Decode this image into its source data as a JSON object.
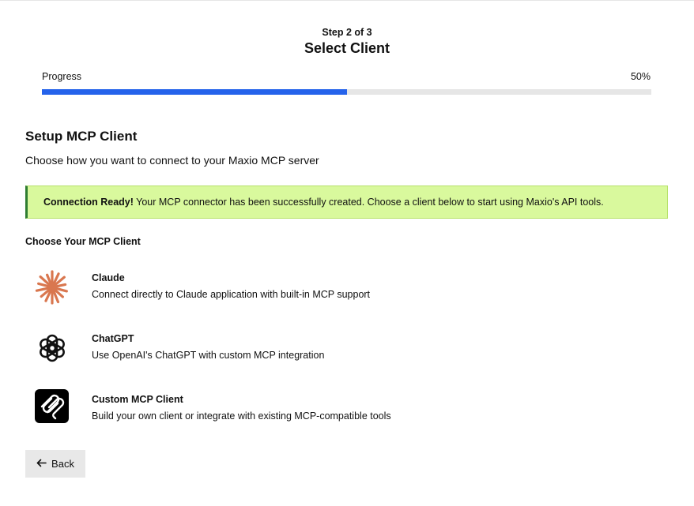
{
  "wizard": {
    "step_label": "Step 2 of 3",
    "title": "Select Client",
    "progress_label": "Progress",
    "progress_text": "50%",
    "progress_fraction": 0.5,
    "accent_color": "#2563eb"
  },
  "setup": {
    "title": "Setup MCP Client",
    "subtitle": "Choose how you want to connect to your Maxio MCP server"
  },
  "alert": {
    "strong": "Connection Ready!",
    "text": " Your MCP connector has been successfully created. Choose a client below to start using Maxio's API tools.",
    "background": "#d9f99d"
  },
  "clients": {
    "heading": "Choose Your MCP Client",
    "items": [
      {
        "icon": "claude-icon",
        "name": "Claude",
        "description": "Connect directly to Claude application with built-in MCP support"
      },
      {
        "icon": "chatgpt-icon",
        "name": "ChatGPT",
        "description": "Use OpenAI's ChatGPT with custom MCP integration"
      },
      {
        "icon": "mcp-icon",
        "name": "Custom MCP Client",
        "description": "Build your own client or integrate with existing MCP-compatible tools"
      }
    ]
  },
  "footer": {
    "back_label": "Back",
    "back_icon": "arrow-left-icon"
  }
}
